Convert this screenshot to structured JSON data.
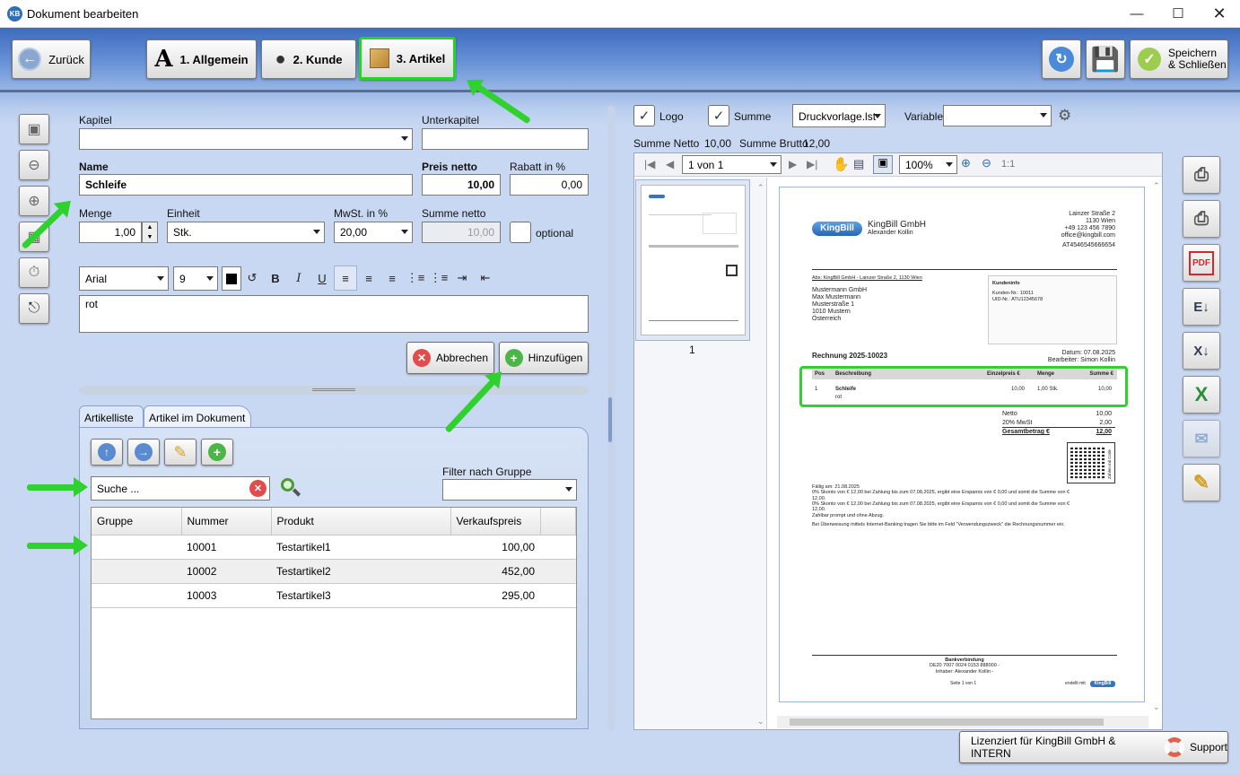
{
  "window": {
    "title": "Dokument bearbeiten",
    "logo": "KB"
  },
  "toolbar": {
    "back": "Zurück",
    "tab1": "1. Allgemein",
    "tab2": "2. Kunde",
    "tab3": "3. Artikel",
    "save_close_line1": "Speichern",
    "save_close_line2": "& Schließen"
  },
  "form": {
    "kapitel_label": "Kapitel",
    "unterkapitel_label": "Unterkapitel",
    "name_label": "Name",
    "name_value": "Schleife",
    "preis_label": "Preis netto",
    "preis_value": "10,00",
    "rabatt_label": "Rabatt in %",
    "rabatt_value": "0,00",
    "menge_label": "Menge",
    "menge_value": "1,00",
    "einheit_label": "Einheit",
    "einheit_value": "Stk.",
    "mwst_label": "MwSt. in %",
    "mwst_value": "20,00",
    "summe_label": "Summe netto",
    "summe_value": "10,00",
    "optional_label": "optional",
    "font_name": "Arial",
    "font_size": "9",
    "description": "rot",
    "cancel": "Abbrechen",
    "add": "Hinzufügen"
  },
  "list": {
    "tab_list": "Artikelliste",
    "tab_doc": "Artikel im Dokument",
    "search_placeholder": "Suche ...",
    "filter_label": "Filter nach Gruppe",
    "columns": [
      "Gruppe",
      "Nummer",
      "Produkt",
      "Verkaufspreis"
    ],
    "rows": [
      {
        "gruppe": "",
        "nummer": "10001",
        "produkt": "Testartikel1",
        "preis": "100,00"
      },
      {
        "gruppe": "",
        "nummer": "10002",
        "produkt": "Testartikel2",
        "preis": "452,00"
      },
      {
        "gruppe": "",
        "nummer": "10003",
        "produkt": "Testartikel3",
        "preis": "295,00"
      }
    ]
  },
  "preview": {
    "logo_label": "Logo",
    "summe_label": "Summe",
    "template": "Druckvorlage.lst",
    "variable_label": "Variable",
    "summe_netto_label": "Summe Netto",
    "summe_netto": "10,00",
    "summe_brutto_label": "Summe Brutto",
    "summe_brutto": "12,00",
    "page_nav": "1 von 1",
    "zoom": "100%",
    "zoom_actual": "1:1",
    "thumb_page": "1"
  },
  "invoice": {
    "brand": "KingBill",
    "company": "KingBill GmbH",
    "person": "Alexander Kollin",
    "address_right": [
      "Lainzer Straße 2",
      "1130 Wien",
      "+49 123 456 7890",
      "office@kingbill.com",
      "",
      "AT4546545666654"
    ],
    "sender_line": "Abs: KingBill GmbH - Lainzer Straße 2, 1130 Wien",
    "recipient": [
      "Mustermann GmbH",
      "Max Mustermann",
      "Musterstraße 1",
      "1010 Mustern",
      "Österreich"
    ],
    "kundeninfo_title": "Kundeninfo",
    "kundeninfo": [
      "Kunden-Nr.:      10011",
      "UID-Nr.:        ATU12345678"
    ],
    "invoice_title": "Rechnung 2025-10023",
    "datum": "Datum: 07.08.2025",
    "bearbeiter": "Bearbeiter: Simon Kollin",
    "table_head": [
      "Pos",
      "Beschreibung",
      "Einzelpreis €",
      "Menge",
      "Summe €"
    ],
    "line": {
      "pos": "1",
      "name": "Schleife",
      "desc": "rot",
      "price": "10,00",
      "qty": "1,00 Stk.",
      "sum": "10,00"
    },
    "netto_label": "Netto",
    "netto": "10,00",
    "mwst_label": "20% MwSt",
    "mwst": "2,00",
    "gesamt_label": "Gesamtbetrag €",
    "gesamt": "12,00",
    "qr_caption": "Zahlen mit Code",
    "notes": [
      "Fällig am: 21.08.2025",
      "0% Skonto von € 12,00 bei Zahlung bis zum 07.08.2025, ergibt eine Ersparnis von € 0,00 und somit die Summe von €",
      "12,00.",
      "0% Skonto von € 12,00 bei Zahlung bis zum 07.08.2025, ergibt eine Ersparnis von € 0,00 und somit die Summe von €",
      "12,00.",
      "Zahlbar prompt und ohne Abzug.",
      "",
      "Bei Überweisung mittels Internet-Banking tragen Sie bitte im Feld \"Verwendungszweck\" die Rechnungsnummer ein."
    ],
    "bank_title": "Bankverbindung",
    "bank_lines": [
      "DE20 7007 0024 0153 888000 -",
      "Inhaber: Alexander Kollin -"
    ],
    "page_footer": "Seite 1 von 1",
    "created_with": "erstellt mit"
  },
  "footer": {
    "license": "Lizenziert für KingBill GmbH & INTERN",
    "support": "Support"
  },
  "colors": {
    "highlight": "#2ed12e",
    "accent": "#3f6fc4"
  }
}
